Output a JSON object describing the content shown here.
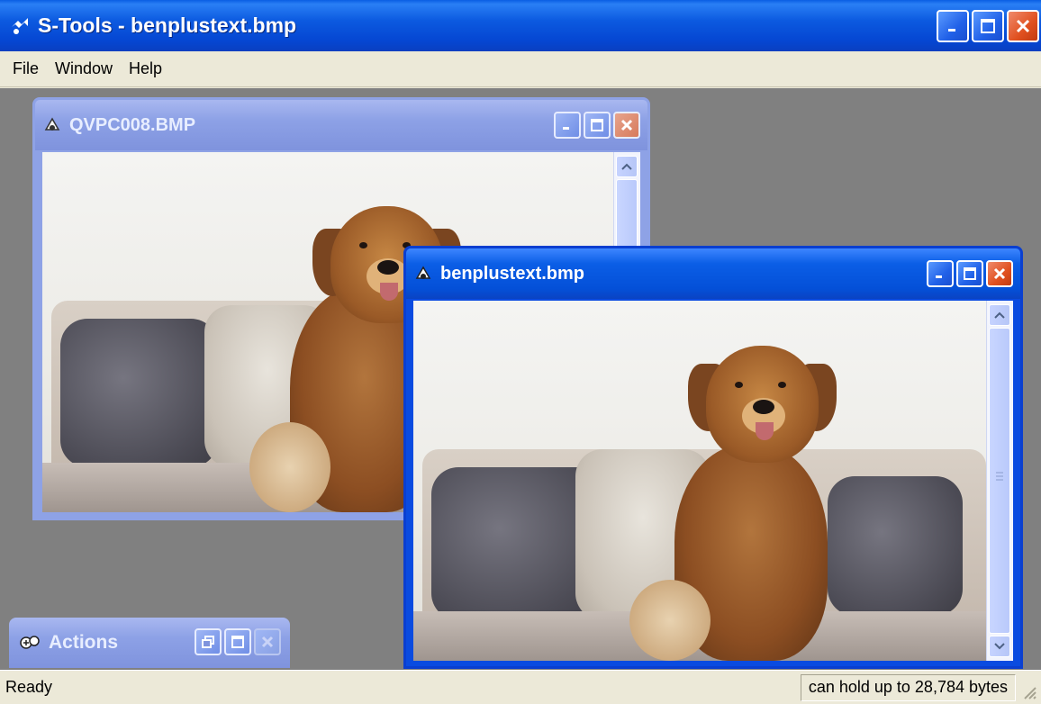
{
  "app": {
    "title": "S-Tools - benplustext.bmp",
    "icon": "s-tools-icon"
  },
  "menu": {
    "items": [
      "File",
      "Window",
      "Help"
    ]
  },
  "windows": {
    "left": {
      "title": "QVPC008.BMP",
      "state": "inactive"
    },
    "right": {
      "title": "benplustext.bmp",
      "state": "active"
    },
    "actions": {
      "title": "Actions",
      "state": "minimized"
    }
  },
  "status": {
    "left": "Ready",
    "right": "can hold up to 28,784 bytes"
  },
  "colors": {
    "titlebar_active": "#0546d2",
    "titlebar_inactive": "#8da1e6",
    "mdi_background": "#808080",
    "close_button": "#e0501f"
  }
}
